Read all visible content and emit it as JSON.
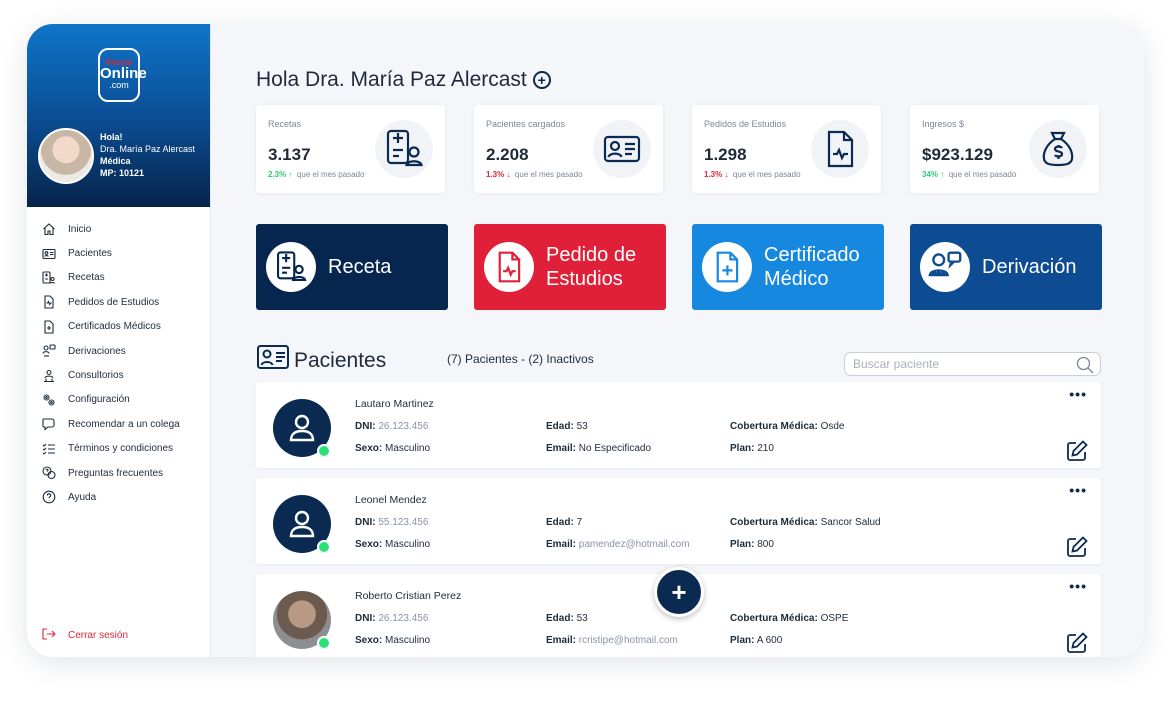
{
  "brand": {
    "logo_line1": "Receta",
    "logo_line2": "Online",
    "logo_line3": ".com"
  },
  "user": {
    "greeting": "Hola!",
    "name": "Dra. María Paz Alercast",
    "role": "Médica",
    "mp": "MP: 10121"
  },
  "nav": {
    "items": [
      {
        "label": "Inicio",
        "icon": "home-icon"
      },
      {
        "label": "Pacientes",
        "icon": "id-card-icon"
      },
      {
        "label": "Recetas",
        "icon": "prescription-icon"
      },
      {
        "label": "Pedidos de Estudios",
        "icon": "study-icon"
      },
      {
        "label": "Certificados Médicos",
        "icon": "certificate-icon"
      },
      {
        "label": "Derivaciones",
        "icon": "referral-icon"
      },
      {
        "label": "Consultorios",
        "icon": "office-icon"
      },
      {
        "label": "Configuración",
        "icon": "gear-icon"
      },
      {
        "label": "Recomendar a un colega",
        "icon": "chat-icon"
      },
      {
        "label": "Términos y condiciones",
        "icon": "checklist-icon"
      },
      {
        "label": "Preguntas frecuentes",
        "icon": "faq-icon"
      },
      {
        "label": "Ayuda",
        "icon": "help-icon"
      }
    ],
    "logout": "Cerrar sesión"
  },
  "header": {
    "title": "Hola Dra. María Paz Alercast"
  },
  "stats": [
    {
      "label": "Recetas",
      "value": "3.137",
      "pct": "2.3%",
      "arrow": "↑",
      "trend": "up",
      "rest": "que el mes pasado",
      "icon": "prescription-icon"
    },
    {
      "label": "Pacientes cargados",
      "value": "2.208",
      "pct": "1.3%",
      "arrow": "↓",
      "trend": "down",
      "rest": "que el mes pasado",
      "icon": "id-card-icon"
    },
    {
      "label": "Pedidos de Estudios",
      "value": "1.298",
      "pct": "1.3%",
      "arrow": "↓",
      "trend": "down",
      "rest": "que el mes pasado",
      "icon": "study-icon"
    },
    {
      "label": "Ingresos $",
      "value": "$923.129",
      "pct": "34%",
      "arrow": "↑",
      "trend": "up",
      "rest": "que el mes pasado",
      "icon": "money-bag-icon"
    }
  ],
  "actions": [
    {
      "line1": "Receta",
      "line2": "",
      "color": "#06264f",
      "icon": "prescription-icon"
    },
    {
      "line1": "Pedido de",
      "line2": "Estudios",
      "color": "#e02038",
      "icon": "study-icon"
    },
    {
      "line1": "Certificado",
      "line2": "Médico",
      "color": "#1688e0",
      "icon": "certificate-icon"
    },
    {
      "line1": "Derivación",
      "line2": "",
      "color": "#0d4c92",
      "icon": "referral-icon"
    }
  ],
  "patients_section": {
    "title": "Pacientes",
    "count": "(7) Pacientes - (2) Inactivos",
    "search_placeholder": "Buscar paciente"
  },
  "labels": {
    "dni": "DNI:",
    "sexo": "Sexo:",
    "edad": "Edad:",
    "email": "Email:",
    "cobertura": "Cobertura Médica:",
    "plan": "Plan:"
  },
  "patients": [
    {
      "name": "Lautaro Martinez",
      "dni": "26.123.456",
      "sexo": "Masculino",
      "edad": "53",
      "email": "No Especificado",
      "cobertura": "Osde",
      "plan": "210"
    },
    {
      "name": "Leonel Mendez",
      "dni": "55.123.456",
      "sexo": "Masculino",
      "edad": "7",
      "email": "pamendez@hotmail.com",
      "cobertura": "Sancor Salud",
      "plan": "800"
    },
    {
      "name": "Roberto Cristian Perez",
      "dni": "26.123.456",
      "sexo": "Masculino",
      "edad": "53",
      "email": "rcristipe@hotmail.com",
      "cobertura": "OSPE",
      "plan": "A 600"
    }
  ],
  "colors": {
    "navy": "#0b2a52",
    "red": "#e0263b",
    "green": "#2ec97a",
    "blue": "#1688e0"
  }
}
